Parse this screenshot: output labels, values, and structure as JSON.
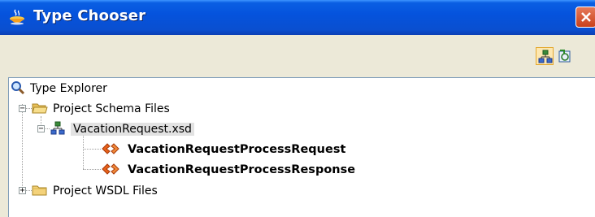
{
  "window": {
    "title": "Type Chooser"
  },
  "toolbar": {
    "buttons": [
      {
        "icon": "schema-icon",
        "selected": true
      },
      {
        "icon": "wsdl-message-icon",
        "selected": false
      }
    ]
  },
  "tree": {
    "root": {
      "label": "Type Explorer",
      "icon": "magnifier-icon"
    },
    "items": [
      {
        "label": "Project Schema Files",
        "icon": "folder-open-icon",
        "expanded": true
      },
      {
        "label": "VacationRequest.xsd",
        "icon": "schema-icon",
        "expanded": true
      },
      {
        "label": "VacationRequestProcessRequest",
        "icon": "element-icon"
      },
      {
        "label": "VacationRequestProcessResponse",
        "icon": "element-icon"
      },
      {
        "label": "Project WSDL Files",
        "icon": "folder-closed-icon",
        "expanded": false
      }
    ],
    "expanders": {
      "expanded": "−",
      "collapsed": "+"
    }
  },
  "colors": {
    "titlebar": "#0553dd",
    "close": "#c9401b",
    "element_icon": "#e8621a",
    "folder": "#f4d27a"
  }
}
